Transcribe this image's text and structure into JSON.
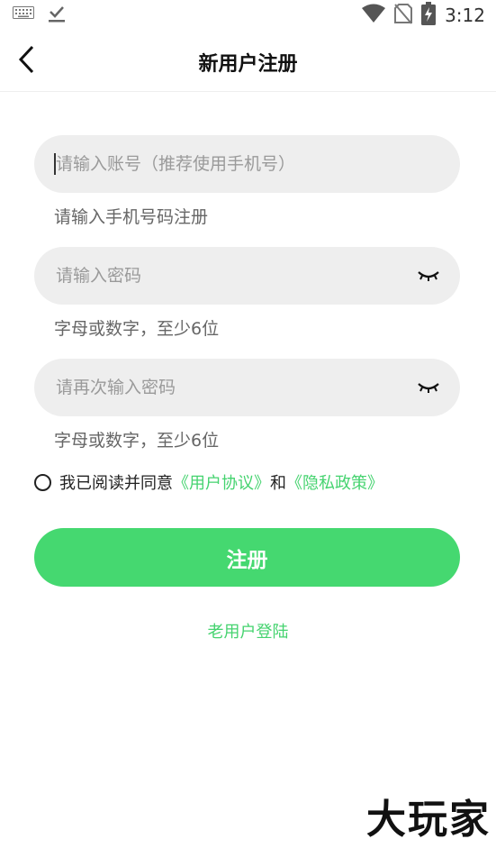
{
  "status_bar": {
    "time": "3:12",
    "icons": [
      "keyboard-icon",
      "download-done-icon",
      "wifi-icon",
      "no-sim-icon",
      "battery-charging-icon"
    ]
  },
  "header": {
    "title": "新用户注册",
    "back_icon": "chevron-left-icon"
  },
  "form": {
    "account": {
      "placeholder": "请输入账号（推荐使用手机号）",
      "value": "",
      "hint": "请输入手机号码注册"
    },
    "password": {
      "placeholder": "请输入密码",
      "value": "",
      "hint": "字母或数字，至少6位",
      "toggle_icon": "eye-closed-icon"
    },
    "confirm_password": {
      "placeholder": "请再次输入密码",
      "value": "",
      "hint": "字母或数字，至少6位",
      "toggle_icon": "eye-closed-icon"
    }
  },
  "agreement": {
    "checked": false,
    "prefix": "我已阅读并同意",
    "user_agreement": "《用户协议》",
    "and": "和",
    "privacy_policy": "《隐私政策》"
  },
  "register_button": "注册",
  "login_link": "老用户登陆",
  "watermark": "大玩家",
  "colors": {
    "accent": "#45d870",
    "link": "#45d36f",
    "field_bg": "#eeeeee"
  }
}
